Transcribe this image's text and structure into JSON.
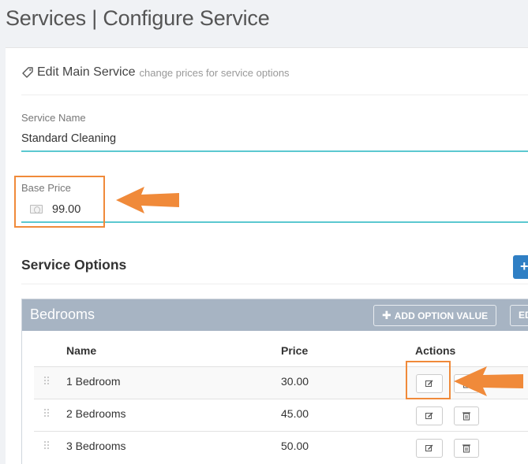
{
  "page": {
    "title": "Services | Configure Service"
  },
  "card": {
    "header_title": "Edit Main Service",
    "header_subtitle": "change prices for service options"
  },
  "service_name": {
    "label": "Service Name",
    "value": "Standard Cleaning"
  },
  "base_price": {
    "label": "Base Price",
    "value": "99.00"
  },
  "service_options": {
    "title": "Service Options",
    "add_button": "+",
    "options": [
      {
        "name": "Bedrooms",
        "add_value_label": "ADD OPTION VALUE",
        "edit_label": "ED",
        "columns": [
          "Name",
          "Price",
          "Actions"
        ],
        "rows": [
          {
            "name": "1 Bedroom",
            "price": "30.00"
          },
          {
            "name": "2 Bedrooms",
            "price": "45.00"
          },
          {
            "name": "3 Bedrooms",
            "price": "50.00"
          }
        ]
      }
    ]
  },
  "colors": {
    "accent_underline": "#5bc8d0",
    "highlight": "#f08a3a",
    "panel_header": "#a7b4c3",
    "primary_button": "#2f7fc4"
  },
  "icons": [
    "tag-icon",
    "money-icon",
    "plus-icon",
    "edit-icon",
    "trash-icon",
    "drag-handle-icon",
    "arrow-left-icon"
  ]
}
